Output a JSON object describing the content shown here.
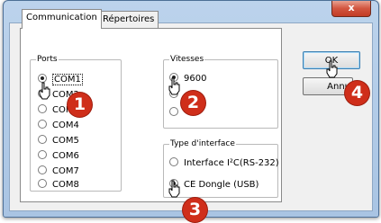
{
  "window": {
    "close_label": "x"
  },
  "tabs": [
    {
      "label": "Communication",
      "active": true
    },
    {
      "label": "Répertoires",
      "active": false
    }
  ],
  "ports": {
    "title": "Ports",
    "items": [
      {
        "label": "COM1",
        "checked": true
      },
      {
        "label": "COM2",
        "checked": false
      },
      {
        "label": "COM3",
        "checked": false
      },
      {
        "label": "COM4",
        "checked": false
      },
      {
        "label": "COM5",
        "checked": false
      },
      {
        "label": "COM6",
        "checked": false
      },
      {
        "label": "COM7",
        "checked": false
      },
      {
        "label": "COM8",
        "checked": false
      }
    ]
  },
  "speeds": {
    "title": "Vitesses",
    "items": [
      {
        "label": "9600",
        "checked": true
      }
    ]
  },
  "interface": {
    "title": "Type d'interface",
    "items": [
      {
        "label": "Interface I²C(RS-232)",
        "checked": false
      },
      {
        "label": "CE Dongle (USB)",
        "checked": true
      }
    ]
  },
  "buttons": {
    "ok": "OK",
    "cancel": "Annu"
  },
  "callouts": [
    "1",
    "2",
    "3",
    "4"
  ],
  "colors": {
    "callout": "#cf2e1a",
    "window_frame": "#a9c4e3",
    "close_button": "#c23c25"
  }
}
